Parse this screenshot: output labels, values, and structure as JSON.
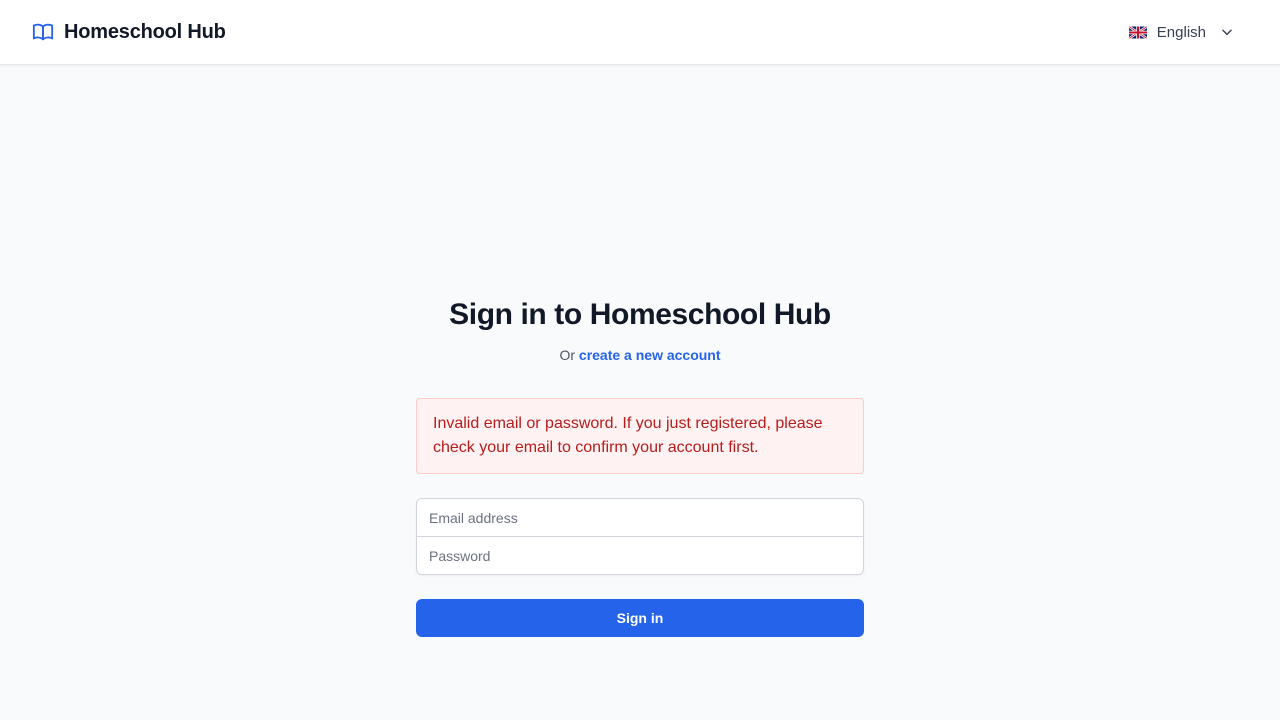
{
  "header": {
    "brand_name": "Homeschool Hub",
    "brand_icon": "book-open-icon",
    "language": {
      "flag_icon": "uk-flag-icon",
      "label": "English",
      "chevron_icon": "chevron-down-icon"
    }
  },
  "login": {
    "title": "Sign in to Homeschool Hub",
    "subtitle_prefix": "Or",
    "create_account_link": "create a new account",
    "error_message": "Invalid email or password. If you just registered, please check your email to confirm your account first.",
    "email_placeholder": "Email address",
    "password_placeholder": "Password",
    "submit_label": "Sign in"
  },
  "colors": {
    "accent": "#2563eb",
    "error_text": "#b91c1c",
    "error_bg": "#fef2f2",
    "error_border": "#fecaca",
    "page_bg": "#f9fafb"
  }
}
